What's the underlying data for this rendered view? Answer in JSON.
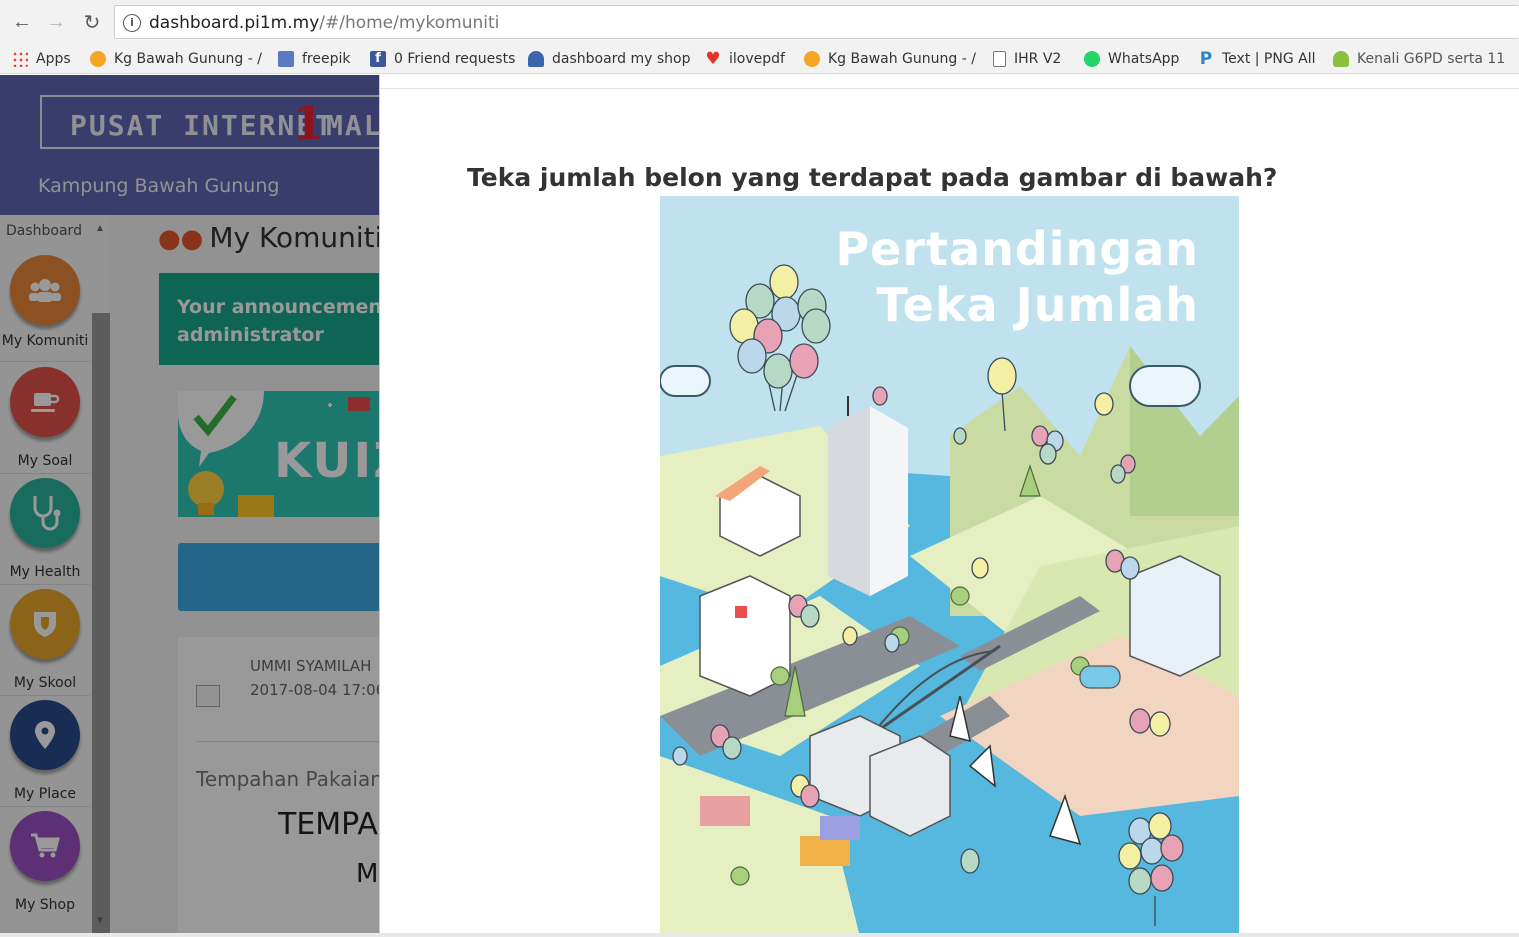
{
  "browser": {
    "url_host": "dashboard.pi1m.my",
    "url_path": "/#/home/mykomuniti",
    "bookmarks": [
      {
        "label": "Apps",
        "icon": "apps-grid-icon",
        "color": "#e94235"
      },
      {
        "label": "Kg Bawah Gunung - /",
        "icon": "joomla-icon",
        "color": "#f4a623"
      },
      {
        "label": "freepik",
        "icon": "freepik-icon",
        "color": "#5a7bbf"
      },
      {
        "label": "0 Friend requests",
        "icon": "facebook-icon",
        "color": "#3b5998"
      },
      {
        "label": "dashboard my shop",
        "icon": "shop-icon",
        "color": "#3a66b0"
      },
      {
        "label": "ilovepdf",
        "icon": "heart-icon",
        "color": "#e5322d"
      },
      {
        "label": "Kg Bawah Gunung - /",
        "icon": "joomla-icon",
        "color": "#f4a623"
      },
      {
        "label": "IHR V2",
        "icon": "page-icon",
        "color": "#888888"
      },
      {
        "label": "WhatsApp",
        "icon": "whatsapp-icon",
        "color": "#25d366"
      },
      {
        "label": "Text | PNG All",
        "icon": "p-logo-icon",
        "color": "#2f86c9"
      },
      {
        "label": "Kenali G6PD serta 11",
        "icon": "android-icon",
        "color": "#8bbf3c"
      }
    ]
  },
  "app": {
    "logo_text": "PUSAT INTERNET",
    "logo_suffix": "MAL",
    "logo_one": "1",
    "location": "Kampung Bawah Gunung",
    "sidebar_title": "Dashboard",
    "sidebar_items": [
      {
        "label": "My Komuniti",
        "icon": "people-icon",
        "color": "#e8873a"
      },
      {
        "label": "My Soal",
        "icon": "cup-icon",
        "color": "#e2504a"
      },
      {
        "label": "My Health",
        "icon": "stethoscope-icon",
        "color": "#2bb59a"
      },
      {
        "label": "My Skool",
        "icon": "shield-icon",
        "color": "#e8a72c"
      },
      {
        "label": "My Place",
        "icon": "location-pin-icon",
        "color": "#2b4a8c"
      },
      {
        "label": "My Shop",
        "icon": "cart-icon",
        "color": "#9b4fc4"
      }
    ],
    "page_title": "My Komuniti",
    "announcement_line1": "Your announcement h",
    "announcement_line2": "administrator",
    "banner_text": "KUIZ",
    "post": {
      "author": "UMMI SYAMILAH",
      "date": "2017-08-04 17:06",
      "subject": "Tempahan Pakaian",
      "headline": "TEMPA",
      "subline": "M"
    }
  },
  "modal": {
    "question": "Teka jumlah belon yang terdapat pada gambar di bawah?",
    "poster_title_line1": "Pertandingan",
    "poster_title_line2": "Teka Jumlah"
  }
}
